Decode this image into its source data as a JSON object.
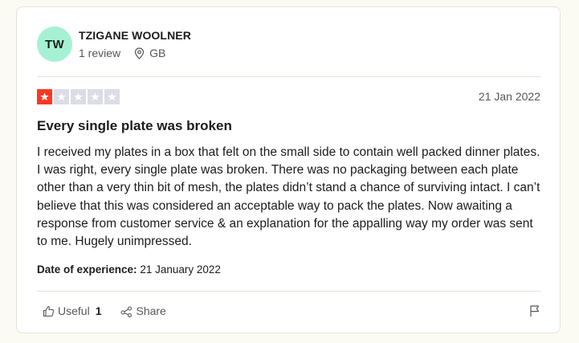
{
  "reviewer": {
    "initials": "TW",
    "name": "TZIGANE WOOLNER",
    "review_count": "1 review",
    "country": "GB",
    "avatar_color": "#a6f1d4"
  },
  "review": {
    "rating": 1,
    "max_rating": 5,
    "star_color": "#ff3722",
    "empty_star_color": "#dcdce6",
    "date": "21 Jan 2022",
    "title": "Every single plate was broken",
    "body": "I received my plates in a box that felt on the small side to contain well packed dinner plates. I was right, every single plate was broken. There was no packaging between each plate other than a very thin bit of mesh, the plates didn’t stand a chance of surviving intact. I can’t believe that this was considered an acceptable way to pack the plates. Now awaiting a response from customer service & an explanation for the appalling way my order was sent to me. Hugely unimpressed.",
    "experience_label": "Date of experience:",
    "experience_date": "21 January 2022"
  },
  "actions": {
    "useful_label": "Useful",
    "useful_count": "1",
    "share_label": "Share",
    "icons": [
      "thumbs-up-icon",
      "share-icon",
      "flag-icon",
      "location-pin-icon",
      "star-icon"
    ]
  }
}
